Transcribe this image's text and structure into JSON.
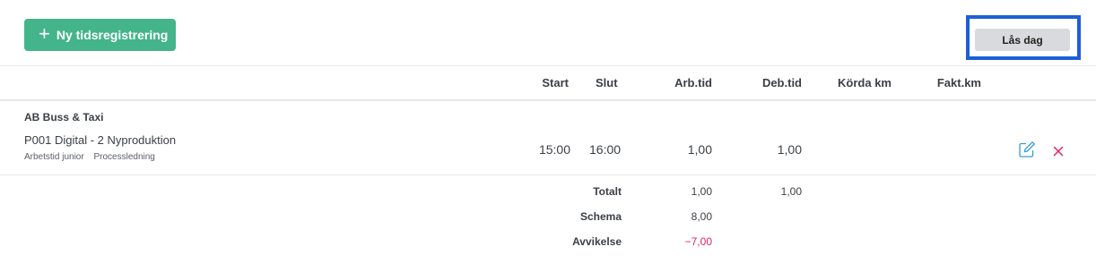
{
  "toolbar": {
    "new_label": "Ny tidsregistrering",
    "lock_label": "Lås dag"
  },
  "columns": {
    "start": "Start",
    "slut": "Slut",
    "arbtid": "Arb.tid",
    "debtid": "Deb.tid",
    "korda_km": "Körda km",
    "fakt_km": "Fakt.km"
  },
  "entry": {
    "client": "AB Buss & Taxi",
    "project": "P001 Digital - 2 Nyproduktion",
    "tags": [
      "Arbetstid junior",
      "Processledning"
    ],
    "start": "15:00",
    "slut": "16:00",
    "arbtid": "1,00",
    "debtid": "1,00"
  },
  "totals": {
    "totalt_label": "Totalt",
    "totalt_arb": "1,00",
    "totalt_deb": "1,00",
    "schema_label": "Schema",
    "schema_arb": "8,00",
    "avvikelse_label": "Avvikelse",
    "avvikelse_arb": "−7,00"
  },
  "icons": {
    "plus": "plus-icon",
    "edit": "edit-icon",
    "delete": "close-icon"
  },
  "colors": {
    "primary": "#44b48a",
    "highlight_border": "#1c5fd6",
    "negative": "#e0245e",
    "edit_icon": "#3a9bd8"
  }
}
